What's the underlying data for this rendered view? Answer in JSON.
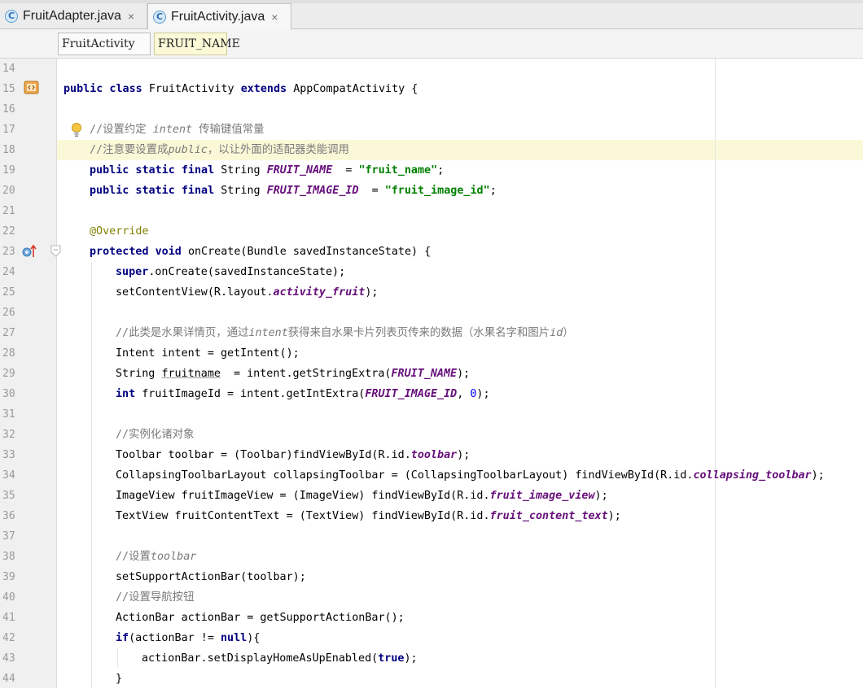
{
  "tabs": [
    {
      "label": "FruitAdapter.java",
      "close": "×",
      "icon": "C"
    },
    {
      "label": "FruitActivity.java",
      "close": "×",
      "icon": "C"
    }
  ],
  "breadcrumb": [
    "FruitActivity",
    "FRUIT_NAME"
  ],
  "lines": [
    {
      "n": "14",
      "segs": []
    },
    {
      "n": "15",
      "segs": [
        [
          "kw",
          "public class "
        ],
        [
          "",
          "FruitActivity "
        ],
        [
          "kw",
          "extends "
        ],
        [
          "",
          "AppCompatActivity {"
        ]
      ]
    },
    {
      "n": "16",
      "segs": []
    },
    {
      "n": "17",
      "segs": [
        [
          "",
          "  "
        ],
        [
          "cmn",
          "//设置约定 "
        ],
        [
          "cm",
          "intent"
        ],
        [
          "cmn",
          " 传输键值常量"
        ]
      ]
    },
    {
      "n": "18",
      "segs": [
        [
          "",
          "  "
        ],
        [
          "cmn",
          "//注意要设置成"
        ],
        [
          "cm",
          "public"
        ],
        [
          "cmn",
          "，以让外面的适配器类能调用"
        ]
      ]
    },
    {
      "n": "19",
      "segs": [
        [
          "",
          "  "
        ],
        [
          "kw",
          "public static final "
        ],
        [
          "",
          "String "
        ],
        [
          "cf",
          "FRUIT_NAME"
        ],
        [
          "",
          " = "
        ],
        [
          "st",
          "\"fruit_name\""
        ],
        [
          "",
          ";"
        ]
      ]
    },
    {
      "n": "20",
      "segs": [
        [
          "",
          "  "
        ],
        [
          "kw",
          "public static final "
        ],
        [
          "",
          "String "
        ],
        [
          "cf",
          "FRUIT_IMAGE_ID"
        ],
        [
          "",
          " = "
        ],
        [
          "st",
          "\"fruit_image_id\""
        ],
        [
          "",
          ";"
        ]
      ]
    },
    {
      "n": "21",
      "segs": []
    },
    {
      "n": "22",
      "segs": [
        [
          "",
          "  "
        ],
        [
          "an",
          "@Override"
        ]
      ]
    },
    {
      "n": "23",
      "segs": [
        [
          "",
          "  "
        ],
        [
          "kw",
          "protected void "
        ],
        [
          "",
          "onCreate(Bundle savedInstanceState) {"
        ]
      ]
    },
    {
      "n": "24",
      "segs": [
        [
          "",
          "    "
        ],
        [
          "kw",
          "super"
        ],
        [
          "",
          ".onCreate(savedInstanceState);"
        ]
      ]
    },
    {
      "n": "25",
      "segs": [
        [
          "",
          "    setContentView(R.layout."
        ],
        [
          "cf",
          "activity_fruit"
        ],
        [
          "",
          ");"
        ]
      ]
    },
    {
      "n": "26",
      "segs": []
    },
    {
      "n": "27",
      "segs": [
        [
          "",
          "    "
        ],
        [
          "cmn",
          "//此类是水果详情页，通过"
        ],
        [
          "cm",
          "intent"
        ],
        [
          "cmn",
          "获得来自水果卡片列表页传来的数据（水果名字和图片"
        ],
        [
          "cm",
          "id"
        ],
        [
          "cmn",
          "）"
        ]
      ]
    },
    {
      "n": "28",
      "segs": [
        [
          "",
          "    Intent intent = getIntent();"
        ]
      ]
    },
    {
      "n": "29",
      "segs": [
        [
          "",
          "    String "
        ],
        [
          "ul",
          "fruitname"
        ],
        [
          "",
          " = intent.getStringExtra("
        ],
        [
          "cf",
          "FRUIT_NAME"
        ],
        [
          "",
          ");"
        ]
      ]
    },
    {
      "n": "30",
      "segs": [
        [
          "",
          "    "
        ],
        [
          "kw",
          "int "
        ],
        [
          "",
          "fruitImageId = intent.getIntExtra("
        ],
        [
          "cf",
          "FRUIT_IMAGE_ID"
        ],
        [
          "",
          ", "
        ],
        [
          "nm",
          "0"
        ],
        [
          "",
          ");"
        ]
      ]
    },
    {
      "n": "31",
      "segs": []
    },
    {
      "n": "32",
      "segs": [
        [
          "",
          "    "
        ],
        [
          "cmn",
          "//实例化诸对象"
        ]
      ]
    },
    {
      "n": "33",
      "segs": [
        [
          "",
          "    Toolbar toolbar = (Toolbar)findViewById(R.id."
        ],
        [
          "cf",
          "toolbar"
        ],
        [
          "",
          ");"
        ]
      ]
    },
    {
      "n": "34",
      "segs": [
        [
          "",
          "    CollapsingToolbarLayout collapsingToolbar = (CollapsingToolbarLayout) findViewById(R.id."
        ],
        [
          "cf",
          "collapsing_toolbar"
        ],
        [
          "",
          ");"
        ]
      ]
    },
    {
      "n": "35",
      "segs": [
        [
          "",
          "    ImageView fruitImageView = (ImageView) findViewById(R.id."
        ],
        [
          "cf",
          "fruit_image_view"
        ],
        [
          "",
          ");"
        ]
      ]
    },
    {
      "n": "36",
      "segs": [
        [
          "",
          "    TextView fruitContentText = (TextView) findViewById(R.id."
        ],
        [
          "cf",
          "fruit_content_text"
        ],
        [
          "",
          ");"
        ]
      ]
    },
    {
      "n": "37",
      "segs": []
    },
    {
      "n": "38",
      "segs": [
        [
          "",
          "    "
        ],
        [
          "cmn",
          "//设置"
        ],
        [
          "cm",
          "toolbar"
        ]
      ]
    },
    {
      "n": "39",
      "segs": [
        [
          "",
          "    setSupportActionBar(toolbar);"
        ]
      ]
    },
    {
      "n": "40",
      "segs": [
        [
          "",
          "    "
        ],
        [
          "cmn",
          "//设置导航按钮"
        ]
      ]
    },
    {
      "n": "41",
      "segs": [
        [
          "",
          "    ActionBar actionBar = getSupportActionBar();"
        ]
      ]
    },
    {
      "n": "42",
      "segs": [
        [
          "",
          "    "
        ],
        [
          "kw",
          "if"
        ],
        [
          "",
          "(actionBar != "
        ],
        [
          "kw",
          "null"
        ],
        [
          "",
          "){"
        ]
      ]
    },
    {
      "n": "43",
      "segs": [
        [
          "",
          "      actionBar.setDisplayHomeAsUpEnabled("
        ],
        [
          "kw",
          "true"
        ],
        [
          "",
          ");"
        ]
      ]
    },
    {
      "n": "44",
      "segs": [
        [
          "",
          "    }"
        ]
      ]
    }
  ],
  "highlighted_line": "18",
  "colors": {
    "keyword": "#000080",
    "string": "#008000",
    "constant_field": "#660e7a",
    "comment": "#7a7a7a",
    "annotation": "#808000",
    "number": "#0000ff",
    "caret_row": "#fbf8d8"
  },
  "gutter_icons": [
    "class-override-icon",
    "lightbulb-icon",
    "override-method-icon",
    "fold-marker-icon"
  ]
}
